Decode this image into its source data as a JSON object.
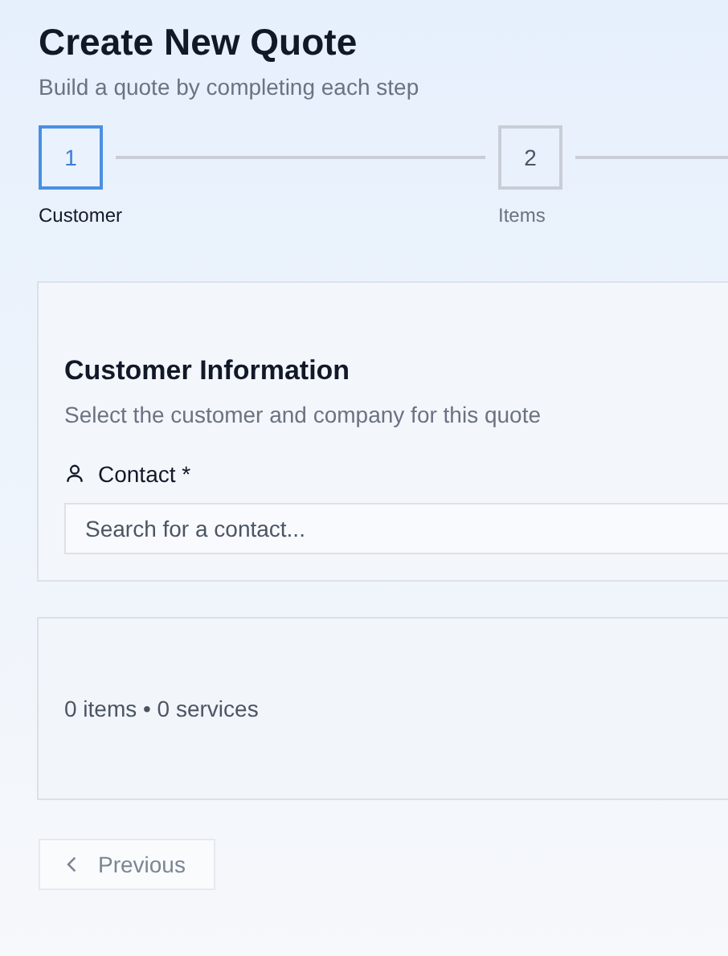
{
  "header": {
    "title": "Create New Quote",
    "subtitle": "Build a quote by completing each step"
  },
  "steps": [
    {
      "number": "1",
      "label": "Customer",
      "selected": true
    },
    {
      "number": "2",
      "label": "Items",
      "selected": false
    }
  ],
  "customer_card": {
    "title": "Customer Information",
    "subtitle": "Select the customer and company for this quote",
    "field": {
      "label": "Contact *",
      "placeholder": "Search for a contact..."
    }
  },
  "summary": {
    "text": "0 items • 0 services"
  },
  "previous_button": {
    "label": "Previous",
    "disabled": true
  }
}
